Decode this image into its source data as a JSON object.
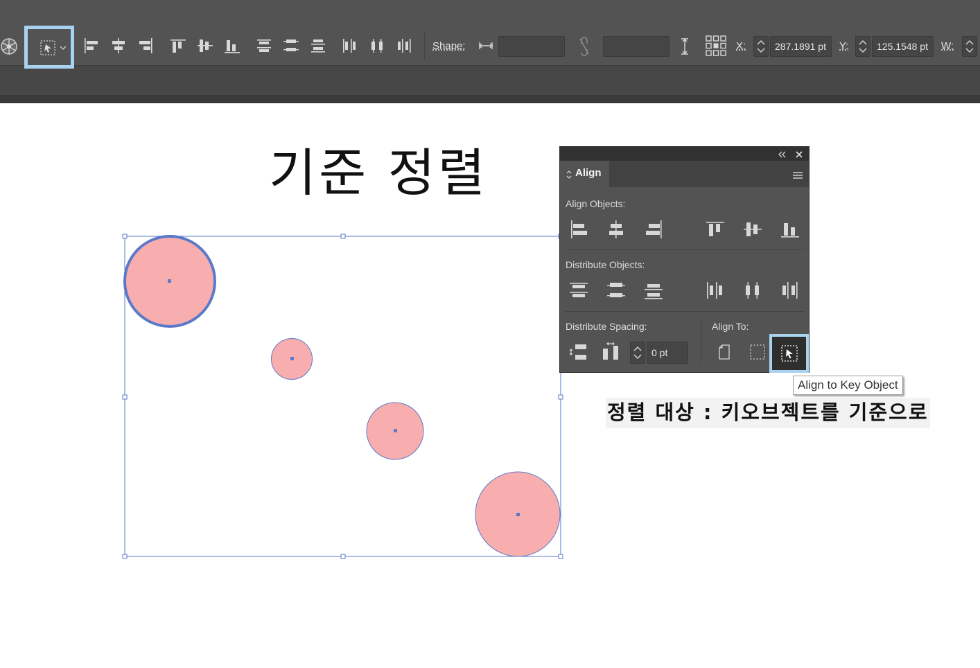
{
  "toolbar": {
    "shape_label": "Shape:",
    "width_value": "",
    "height_value": "",
    "x_label": "X:",
    "x_value": "287.1891 pt",
    "y_label": "Y:",
    "y_value": "125.1548 pt",
    "w_label": "W:",
    "align_to_icon": "align-to-key-object-icon",
    "highlight_color": "#a8d2ef"
  },
  "canvas": {
    "heading": "기준 정렬",
    "circle_fill": "#f8aeae",
    "selection_color": "#5b79c8",
    "circles": [
      {
        "name": "key-object-circle",
        "is_key_object": true
      },
      {
        "name": "small-circle"
      },
      {
        "name": "medium-circle"
      },
      {
        "name": "large-circle"
      }
    ]
  },
  "align_panel": {
    "tab_label": "Align",
    "align_objects_label": "Align Objects:",
    "distribute_objects_label": "Distribute Objects:",
    "distribute_spacing_label": "Distribute Spacing:",
    "spacing_value": "0 pt",
    "align_to_label": "Align To:",
    "tooltip": "Align to Key Object"
  },
  "caption": "정렬 대상 : 키오브젝트를 기준으로"
}
